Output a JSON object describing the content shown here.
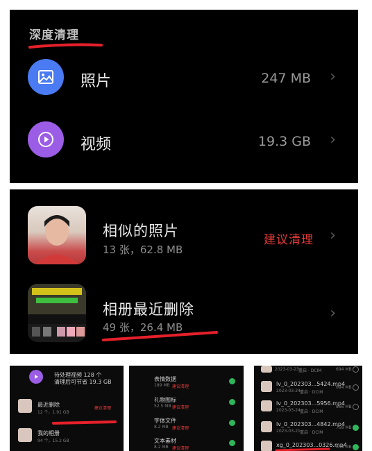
{
  "deep_clean": {
    "title": "深度清理",
    "items": [
      {
        "label": "照片",
        "size": "247 MB",
        "icon": "photo-icon",
        "color": "#4a7bf2"
      },
      {
        "label": "视频",
        "size": "19.3 GB",
        "icon": "play-icon",
        "color": "#9b5de5"
      }
    ]
  },
  "photo_groups": {
    "similar": {
      "title": "相似的照片",
      "subtitle": "13 张，62.8 MB",
      "action": "建议清理"
    },
    "recent_deleted": {
      "title": "相册最近删除",
      "subtitle": "49 张，26.4 MB"
    }
  },
  "video_panel": {
    "pending_line1": "待处理视频 128 个",
    "pending_line2": "清理后可节省 19.3 GB",
    "items": [
      {
        "title": "最近删除",
        "sub": "12 个，1.91 GB",
        "action": "建议清理"
      },
      {
        "title": "我的相册",
        "sub": "94 个，15.2 GB"
      }
    ]
  },
  "data_panel": {
    "items": [
      {
        "title": "表情数据",
        "size": "189 MB",
        "note": "建议清理"
      },
      {
        "title": "礼物图标",
        "size": "52.5 MB",
        "note": "建议清理"
      },
      {
        "title": "字体文件",
        "size": "8.2 MB",
        "note": "建议清理"
      },
      {
        "title": "文本素材",
        "size": "8.2 MB",
        "note": "建议清理"
      }
    ]
  },
  "file_panel": {
    "items": [
      {
        "name": "",
        "date": "2023-03-23",
        "meta": "重启 · DCIM",
        "size": "694 MB",
        "checked": false
      },
      {
        "name": "lv_0_202303...5424.mp4",
        "date": "2023-03-24",
        "meta": "重启 · DCIM",
        "size": "694 MB",
        "checked": false
      },
      {
        "name": "lv_0_202303...5956.mp4",
        "date": "2023-03-24",
        "meta": "重启 · DCIM",
        "size": "866 MB",
        "checked": false
      },
      {
        "name": "lv_0_202303...4842.mp4",
        "date": "2023-03-21",
        "meta": "重启 · DCIM",
        "size": "758 MB",
        "checked": true
      },
      {
        "name": "xg_0_202303...0326.mp4",
        "date": "",
        "meta": "",
        "size": "639 MB",
        "checked": true
      }
    ]
  },
  "chevron": "›"
}
